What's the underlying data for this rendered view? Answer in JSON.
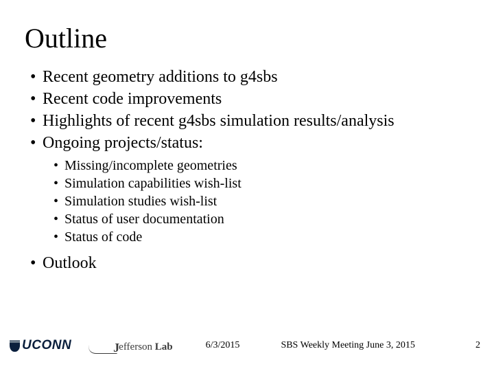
{
  "title": "Outline",
  "bullets": {
    "b0": "Recent geometry additions to g4sbs",
    "b1": "Recent code improvements",
    "b2": "Highlights of recent g4sbs simulation results/analysis",
    "b3": "Ongoing projects/status:",
    "b4": "Outlook"
  },
  "sub": {
    "s0": "Missing/incomplete geometries",
    "s1": "Simulation capabilities wish-list",
    "s2": "Simulation studies wish-list",
    "s3": "Status of user documentation",
    "s4": "Status of code"
  },
  "footer": {
    "uconn": "UCONN",
    "jlab_eff": "efferson ",
    "jlab_lab": "Lab",
    "date": "6/3/2015",
    "meeting": "SBS Weekly Meeting June 3, 2015",
    "page": "2"
  }
}
